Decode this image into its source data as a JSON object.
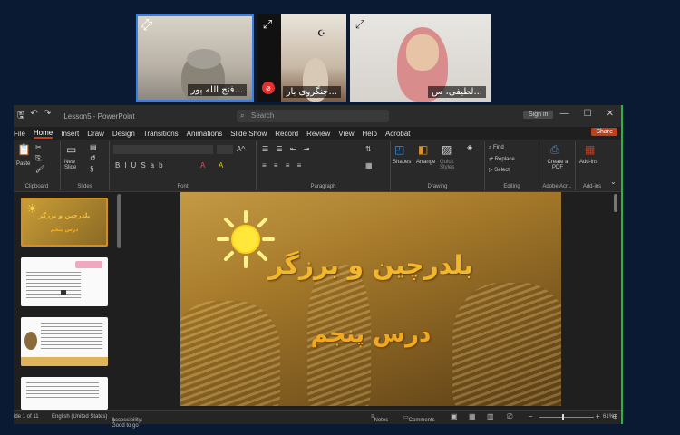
{
  "meeting": {
    "participants": [
      {
        "name": "فتح الله پور...",
        "muted": false,
        "active": true
      },
      {
        "name": "",
        "muted": true,
        "active": false
      },
      {
        "name": "جنگروی بار...",
        "muted": false,
        "active": false
      },
      {
        "name": "لطیفی، س...",
        "muted": false,
        "active": false
      }
    ]
  },
  "ppt": {
    "title_file": "Lesson5 - PowerPoint",
    "search_placeholder": "Search",
    "signin_label": "Sign in",
    "menu": [
      "File",
      "Home",
      "Insert",
      "Draw",
      "Design",
      "Transitions",
      "Animations",
      "Slide Show",
      "Record",
      "Review",
      "View",
      "Help",
      "Acrobat"
    ],
    "active_menu": "Home",
    "share_label": "Share",
    "ribbon": {
      "paste": "Paste",
      "new_slide": "New Slide",
      "shapes": "Shapes",
      "arrange": "Arrange",
      "quick_styles": "Quick Styles",
      "find": "Find",
      "replace": "Replace",
      "select": "Select",
      "create_pdf": "Create a PDF",
      "addins": "Add-ins",
      "groups": [
        "Clipboard",
        "Slides",
        "Font",
        "Paragraph",
        "Drawing",
        "Editing",
        "Adobe Acr...",
        "Add-ins"
      ]
    },
    "slide": {
      "title": "بلدرچین و برزگر",
      "subtitle": "درس پنجم"
    },
    "thumb_text": {
      "t1_title": "بلدرچین و برزگر",
      "t1_sub": "درس پنجم"
    },
    "status": {
      "slide_count": "ide 1 of 11",
      "language": "English (United States)",
      "accessibility": "Accessibility: Good to go",
      "notes": "Notes",
      "comments": "Comments",
      "zoom": "61%"
    }
  }
}
